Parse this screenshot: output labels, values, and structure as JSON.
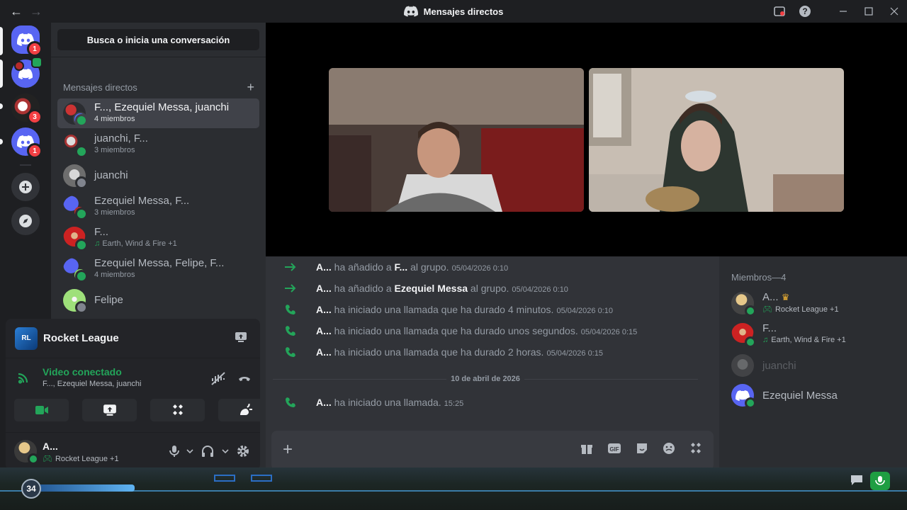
{
  "window": {
    "title": "Mensajes directos"
  },
  "rail": {
    "servers": [
      {
        "badge": "1"
      },
      {
        "badge": ""
      },
      {
        "badge": "3"
      },
      {
        "badge": "1"
      }
    ]
  },
  "dm": {
    "search_placeholder": "Busca o inicia una conversación",
    "header": "Mensajes directos",
    "items": [
      {
        "name": "F..., Ezequiel Messa, juanchi",
        "sub": "4 miembros"
      },
      {
        "name": "juanchi, F...",
        "sub": "3 miembros"
      },
      {
        "name": "juanchi",
        "sub": ""
      },
      {
        "name": "Ezequiel Messa, F...",
        "sub": "3 miembros"
      },
      {
        "name": "F...",
        "sub": "Earth, Wind & Fire +1"
      },
      {
        "name": "Ezequiel Messa, Felipe, F...",
        "sub": "4 miembros"
      },
      {
        "name": "Felipe",
        "sub": ""
      }
    ]
  },
  "voice": {
    "game": "Rocket League",
    "status": "Video conectado",
    "channel": "F..., Ezequiel Messa, juanchi"
  },
  "user": {
    "name": "A...",
    "activity": "Rocket League +1"
  },
  "chat": {
    "messages": [
      {
        "author": "A...",
        "pre": "ha añadido a",
        "target": "F...",
        "post": "al grupo.",
        "time": "05/04/2026 0:10"
      },
      {
        "author": "A...",
        "pre": "ha añadido a",
        "target": "Ezequiel Messa",
        "post": "al grupo.",
        "time": "05/04/2026 0:10"
      },
      {
        "author": "A...",
        "pre": "ha iniciado una llamada que ha durado 4 minutos.",
        "time": "05/04/2026 0:10"
      },
      {
        "author": "A...",
        "pre": "ha iniciado una llamada que ha durado unos segundos.",
        "time": "05/04/2026 0:15"
      },
      {
        "author": "A...",
        "pre": "ha iniciado una llamada que ha durado 2 horas.",
        "time": "05/04/2026 0:15"
      },
      {
        "author": "A...",
        "pre": "ha iniciado una llamada.",
        "time": "15:25"
      }
    ],
    "date_divider": "10 de abril de 2026"
  },
  "members": {
    "header": "Miembros—4",
    "list": [
      {
        "name": "A...",
        "sub": "Rocket League +1"
      },
      {
        "name": "F...",
        "sub": "Earth, Wind & Fire +1"
      },
      {
        "name": "juanchi",
        "sub": ""
      },
      {
        "name": "Ezequiel Messa",
        "sub": ""
      }
    ]
  },
  "game_overlay": {
    "level": "34"
  },
  "colors": {
    "online": "#23a55a",
    "blurple": "#5865f2",
    "danger": "#f23f43"
  }
}
